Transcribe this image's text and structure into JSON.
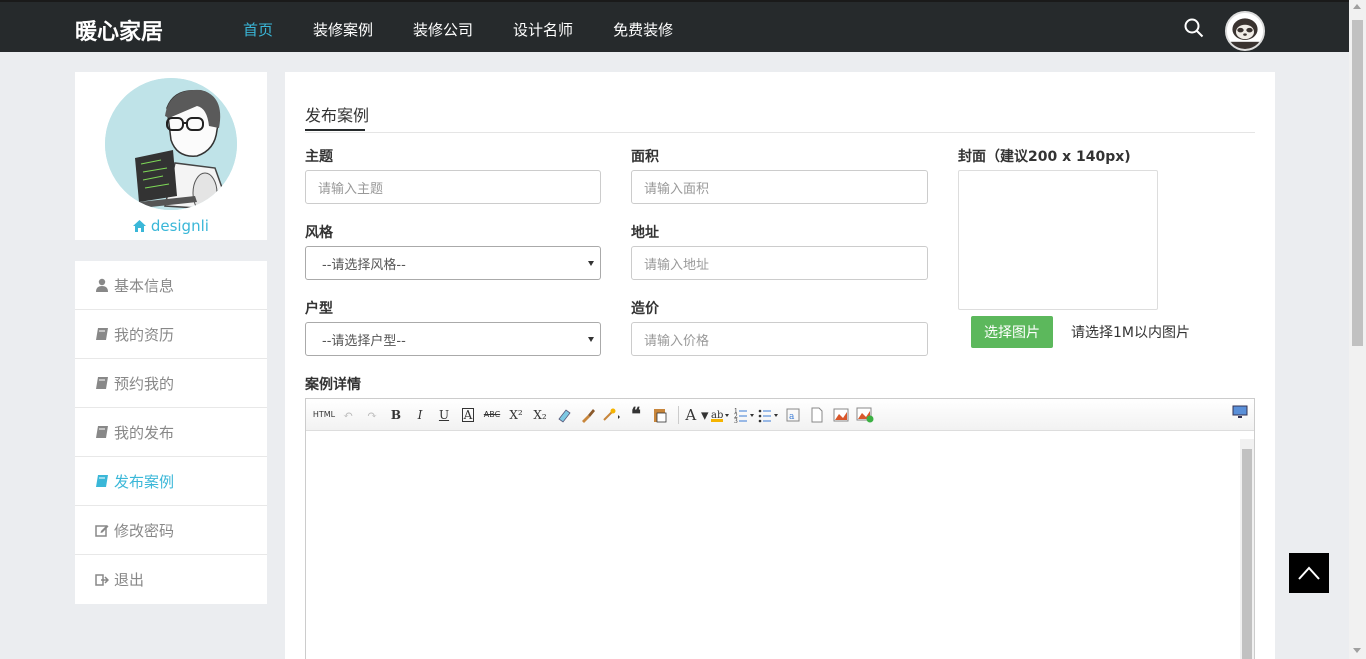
{
  "header": {
    "logo": "暖心家居",
    "nav": [
      {
        "label": "首页",
        "active": true
      },
      {
        "label": "装修案例",
        "active": false
      },
      {
        "label": "装修公司",
        "active": false
      },
      {
        "label": "设计名师",
        "active": false
      },
      {
        "label": "免费装修",
        "active": false
      }
    ]
  },
  "profile": {
    "name": "designli"
  },
  "menu": [
    {
      "label": "基本信息",
      "icon": "user-icon",
      "active": false
    },
    {
      "label": "我的资历",
      "icon": "book-icon",
      "active": false
    },
    {
      "label": "预约我的",
      "icon": "book-icon",
      "active": false
    },
    {
      "label": "我的发布",
      "icon": "book-icon",
      "active": false
    },
    {
      "label": "发布案例",
      "icon": "book-icon",
      "active": true
    },
    {
      "label": "修改密码",
      "icon": "edit-icon",
      "active": false
    },
    {
      "label": "退出",
      "icon": "signout-icon",
      "active": false
    }
  ],
  "form": {
    "tab_title": "发布案例",
    "subject_label": "主题",
    "subject_placeholder": "请输入主题",
    "area_label": "面积",
    "area_placeholder": "请输入面积",
    "style_label": "风格",
    "style_selected": "--请选择风格--",
    "address_label": "地址",
    "address_placeholder": "请输入地址",
    "house_label": "户型",
    "house_selected": "--请选择户型--",
    "price_label": "造价",
    "price_placeholder": "请输入价格",
    "cover_label": "封面（建议200 x 140px)",
    "cover_button": "选择图片",
    "cover_hint": "请选择1M以内图片",
    "detail_label": "案例详情"
  },
  "editor": {
    "html_label": "HTML"
  },
  "colors": {
    "accent": "#3ab7d8",
    "header_bg": "#262a2c",
    "success": "#5cb85c"
  }
}
